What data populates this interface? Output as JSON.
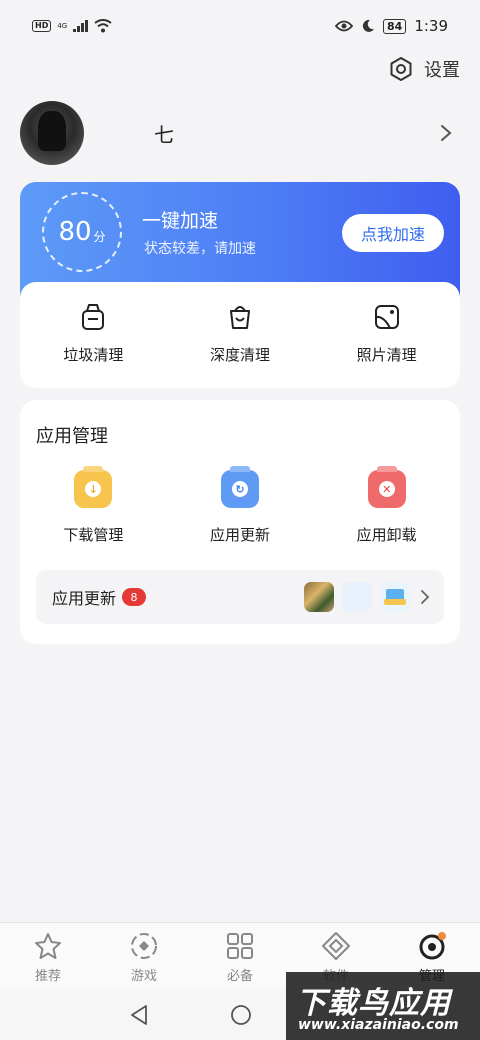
{
  "status_bar": {
    "hd": "HD",
    "net": "4G",
    "battery": "84",
    "time": "1:39"
  },
  "settings": {
    "label": "设置",
    "icon": "settings-hexagon-icon"
  },
  "profile": {
    "username": "七"
  },
  "speed": {
    "score": "80",
    "score_unit": "分",
    "title": "一键加速",
    "subtitle": "状态较差，请加速",
    "button": "点我加速",
    "gradient": [
      "#5d9bf7",
      "#3f5ef0"
    ],
    "button_color": "#2f6df2"
  },
  "clean": [
    {
      "label": "垃圾清理",
      "icon": "trash-bin-icon"
    },
    {
      "label": "深度清理",
      "icon": "deep-clean-icon"
    },
    {
      "label": "照片清理",
      "icon": "photo-icon"
    }
  ],
  "app_manage": {
    "title": "应用管理",
    "items": [
      {
        "label": "下载管理",
        "icon": "download-icon",
        "color": "#f7c44d"
      },
      {
        "label": "应用更新",
        "icon": "update-icon",
        "color": "#5f9af5"
      },
      {
        "label": "应用卸载",
        "icon": "uninstall-icon",
        "color": "#ef6b6b"
      }
    ],
    "update_row": {
      "label": "应用更新",
      "badge": "8"
    }
  },
  "bottom_nav": [
    {
      "label": "推荐",
      "icon": "star-icon"
    },
    {
      "label": "游戏",
      "icon": "game-icon"
    },
    {
      "label": "必备",
      "icon": "grid-icon"
    },
    {
      "label": "软件",
      "icon": "diamond-icon"
    },
    {
      "label": "管理",
      "icon": "manage-icon",
      "active": true
    }
  ],
  "watermark": {
    "title": "下载鸟应用",
    "url": "www.xiazainiao.com"
  }
}
